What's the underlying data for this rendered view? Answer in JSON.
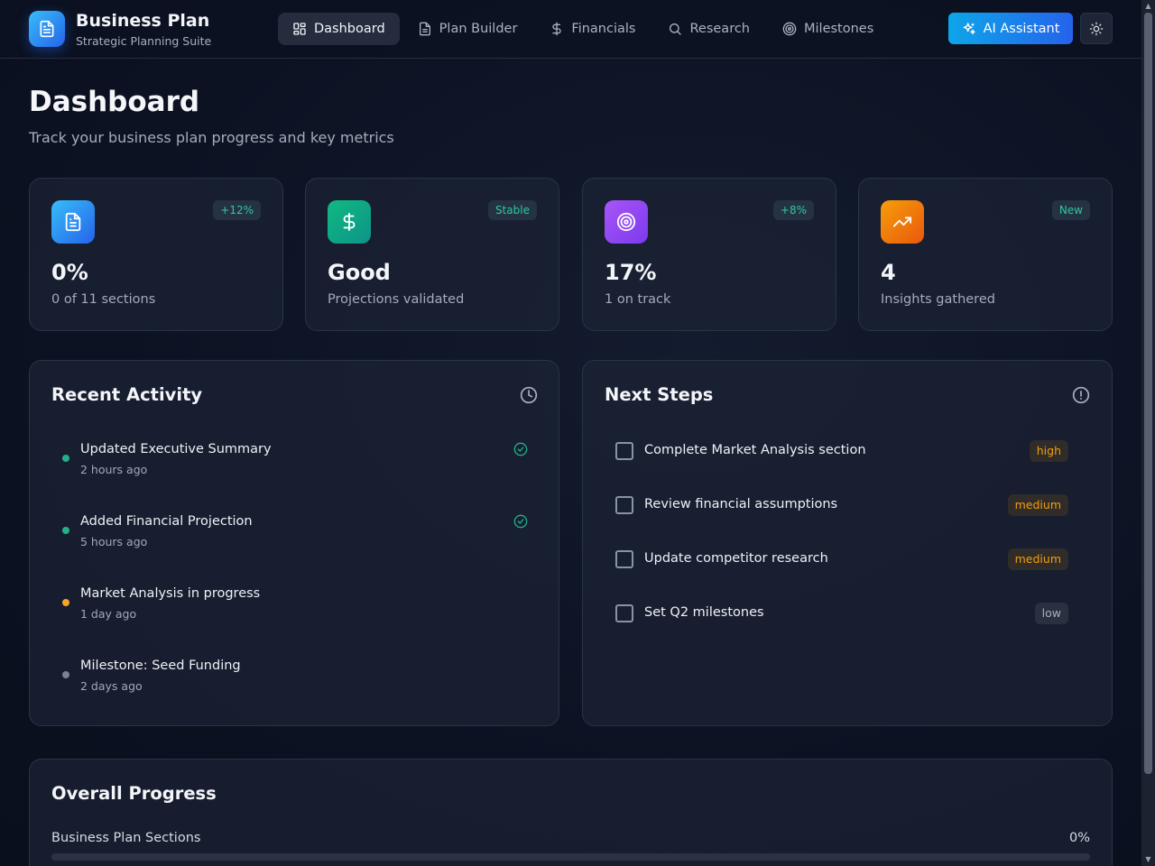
{
  "brand": {
    "title": "Business Plan",
    "subtitle": "Strategic Planning Suite"
  },
  "nav": [
    {
      "label": "Dashboard",
      "icon": "dashboard-icon",
      "active": true
    },
    {
      "label": "Plan Builder",
      "icon": "document-icon",
      "active": false
    },
    {
      "label": "Financials",
      "icon": "dollar-icon",
      "active": false
    },
    {
      "label": "Research",
      "icon": "search-icon",
      "active": false
    },
    {
      "label": "Milestones",
      "icon": "target-icon",
      "active": false
    }
  ],
  "header": {
    "ai_label": "AI Assistant"
  },
  "page": {
    "title": "Dashboard",
    "subtitle": "Track your business plan progress and key metrics"
  },
  "stats": [
    {
      "value": "0%",
      "label": "0 of 11 sections",
      "badge": "+12%",
      "icon": "document-icon",
      "color": "#2a8cf0"
    },
    {
      "value": "Good",
      "label": "Projections validated",
      "badge": "Stable",
      "icon": "dollar-icon",
      "color": "#16a583"
    },
    {
      "value": "17%",
      "label": "1 on track",
      "badge": "+8%",
      "icon": "target-icon",
      "color": "#9b51f0"
    },
    {
      "value": "4",
      "label": "Insights gathered",
      "badge": "New",
      "icon": "trending-up-icon",
      "color": "#f5820e"
    }
  ],
  "activity": {
    "title": "Recent Activity",
    "items": [
      {
        "title": "Updated Executive Summary",
        "time": "2 hours ago",
        "status": "done",
        "dot": "#22b08a"
      },
      {
        "title": "Added Financial Projection",
        "time": "5 hours ago",
        "status": "done",
        "dot": "#22b08a"
      },
      {
        "title": "Market Analysis in progress",
        "time": "1 day ago",
        "status": "in-progress",
        "dot": "#f5a524"
      },
      {
        "title": "Milestone: Seed Funding",
        "time": "2 days ago",
        "status": "pending",
        "dot": "#7a8294"
      }
    ]
  },
  "next_steps": {
    "title": "Next Steps",
    "items": [
      {
        "text": "Complete Market Analysis section",
        "priority": "high"
      },
      {
        "text": "Review financial assumptions",
        "priority": "medium"
      },
      {
        "text": "Update competitor research",
        "priority": "medium"
      },
      {
        "text": "Set Q2 milestones",
        "priority": "low"
      }
    ]
  },
  "progress": {
    "title": "Overall Progress",
    "label": "Business Plan Sections",
    "pct_text": "0%",
    "value": 0
  }
}
